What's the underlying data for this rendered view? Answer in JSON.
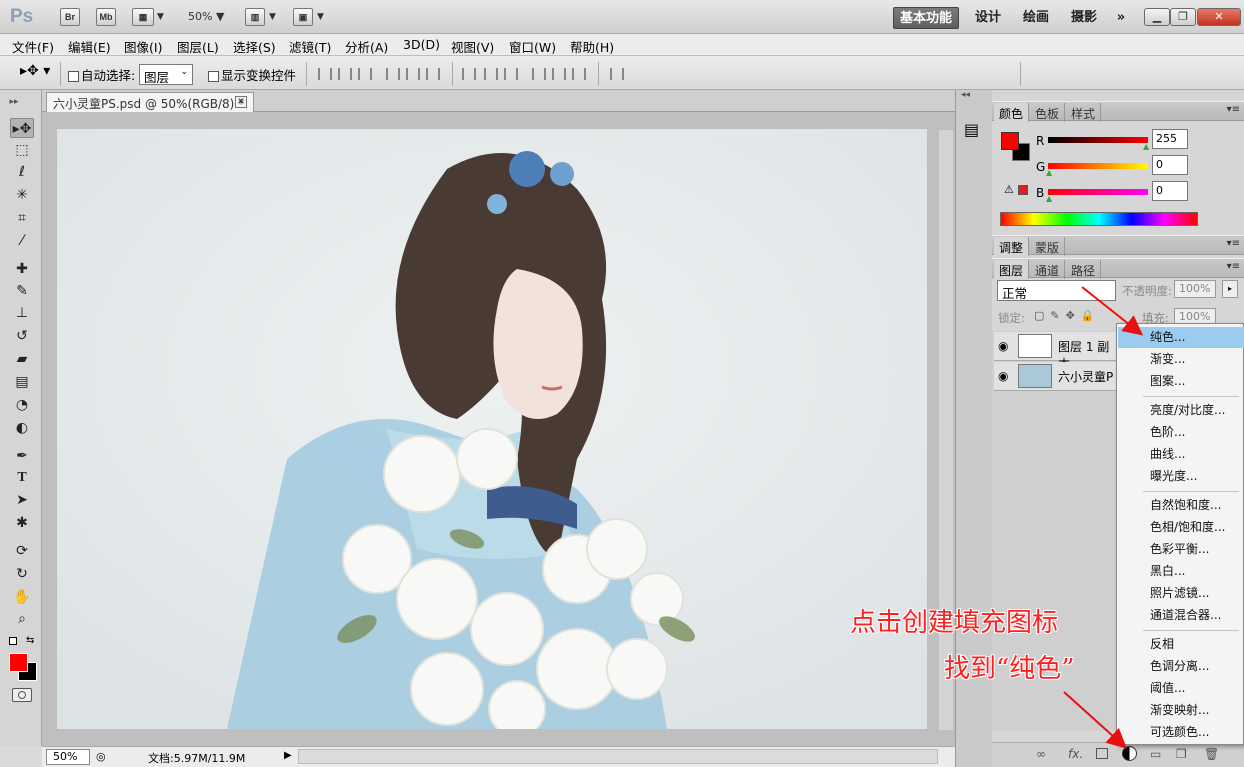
{
  "app": {
    "logo": "Ps",
    "bridge": "Br",
    "minibridge": "Mb",
    "zoom": "50%"
  },
  "workspaces": [
    "基本功能",
    "设计",
    "绘画",
    "摄影"
  ],
  "menu": [
    "文件(F)",
    "编辑(E)",
    "图像(I)",
    "图层(L)",
    "选择(S)",
    "滤镜(T)",
    "分析(A)",
    "3D(D)",
    "视图(V)",
    "窗口(W)",
    "帮助(H)"
  ],
  "options": {
    "auto_select_label": "自动选择:",
    "auto_select_value": "图层",
    "show_transform_label": "显示变换控件"
  },
  "document": {
    "tab_title": "六小灵童PS.psd @ 50%(RGB/8) *",
    "zoom": "50%",
    "doc_size": "文档:5.97M/11.9M"
  },
  "color_panel": {
    "tabs": [
      "颜色",
      "色板",
      "样式"
    ],
    "r_label": "R",
    "g_label": "G",
    "b_label": "B",
    "r": "255",
    "g": "0",
    "b": "0",
    "foreground": "#ff0000",
    "background": "#000000"
  },
  "adjust_panel": {
    "tabs": [
      "调整",
      "蒙版"
    ]
  },
  "layers_panel": {
    "tabs": [
      "图层",
      "通道",
      "路径"
    ],
    "blend_mode": "正常",
    "opacity_label": "不透明度:",
    "opacity": "100%",
    "lock_label": "锁定:",
    "fill_label": "填充:",
    "fill": "100%",
    "layers": [
      {
        "name": "图层 1 副本"
      },
      {
        "name": "六小灵童P"
      }
    ]
  },
  "context_menu": {
    "items": [
      "纯色...",
      "渐变...",
      "图案...",
      "亮度/对比度...",
      "色阶...",
      "曲线...",
      "曝光度...",
      "自然饱和度...",
      "色相/饱和度...",
      "色彩平衡...",
      "黑白...",
      "照片滤镜...",
      "通道混合器...",
      "反相",
      "色调分离...",
      "阈值...",
      "渐变映射...",
      "可选颜色..."
    ],
    "highlighted": "纯色..."
  },
  "annotation": {
    "line1": "点击创建填充图标",
    "line2": "找到“纯色”"
  }
}
